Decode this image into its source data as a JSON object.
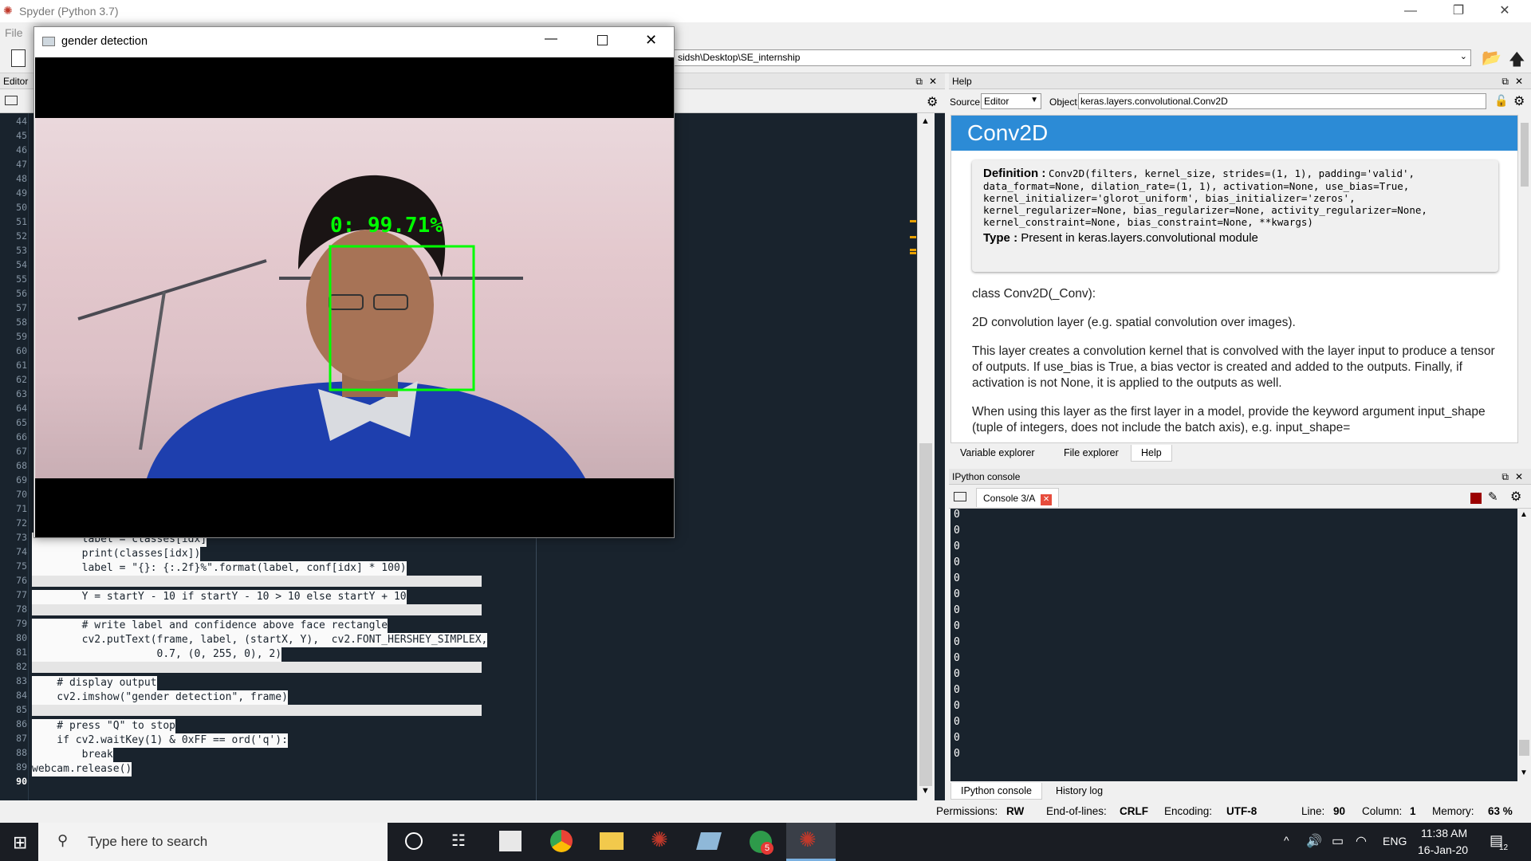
{
  "app": {
    "title": "Spyder (Python 3.7)",
    "menu_file": "File"
  },
  "toolbar": {
    "path": "sidsh\\Desktop\\SE_internship"
  },
  "editor": {
    "pane_title": "Editor",
    "line_numbers": [
      "44",
      "45",
      "46",
      "47",
      "48",
      "49",
      "50",
      "51",
      "52",
      "53",
      "54",
      "55",
      "56",
      "57",
      "58",
      "59",
      "60",
      "61",
      "62",
      "63",
      "64",
      "65",
      "66",
      "67",
      "68",
      "69",
      "70",
      "71",
      "72",
      "73",
      "74",
      "75",
      "76",
      "77",
      "78",
      "79",
      "80",
      "81",
      "82",
      "83",
      "84",
      "85",
      "86",
      "87",
      "88",
      "89",
      "90"
    ],
    "code": {
      "l73": "        label = classes[idx]",
      "l74": "        print(classes[idx])",
      "l75": "        label = \"{}: {:.2f}%\".format(label, conf[idx] * 100)",
      "l77": "        Y = startY - 10 if startY - 10 > 10 else startY + 10",
      "l79": "        # write label and confidence above face rectangle",
      "l80": "        cv2.putText(frame, label, (startX, Y),  cv2.FONT_HERSHEY_SIMPLEX,",
      "l81": "                    0.7, (0, 255, 0), 2)",
      "l83": "    # display output",
      "l84": "    cv2.imshow(\"gender detection\", frame)",
      "l86": "    # press \"Q\" to stop",
      "l87": "    if cv2.waitKey(1) & 0xFF == ord('q'):",
      "l88": "        break",
      "l89": "webcam.release()"
    }
  },
  "help": {
    "pane_title": "Help",
    "source_label": "Source",
    "source_value": "Editor",
    "object_label": "Object",
    "object_value": "keras.layers.convolutional.Conv2D",
    "heading": "Conv2D",
    "definition_label": "Definition :",
    "definition_text": "Conv2D(filters, kernel_size, strides=(1, 1), padding='valid', data_format=None, dilation_rate=(1, 1), activation=None, use_bias=True, kernel_initializer='glorot_uniform', bias_initializer='zeros', kernel_regularizer=None, bias_regularizer=None, activity_regularizer=None, kernel_constraint=None, bias_constraint=None, **kwargs)",
    "type_label": "Type :",
    "type_text": "Present in keras.layers.convolutional module",
    "p1": "class Conv2D(_Conv):",
    "p2": "2D convolution layer (e.g. spatial convolution over images).",
    "p3": "This layer creates a convolution kernel that is convolved with the layer input to produce a tensor of outputs. If use_bias is True, a bias vector is created and added to the outputs. Finally, if activation is not None, it is applied to the outputs as well.",
    "p4": "When using this layer as the first layer in a model, provide the keyword argument input_shape (tuple of integers, does not include the batch axis), e.g. input_shape=",
    "tabs": [
      "Variable explorer",
      "File explorer",
      "Help"
    ]
  },
  "console": {
    "pane_title": "IPython console",
    "tab_label": "Console 3/A",
    "outputs": [
      "0",
      "0",
      "0",
      "0",
      "0",
      "0",
      "0",
      "0",
      "0",
      "0",
      "0",
      "0",
      "0",
      "0",
      "0",
      "0"
    ],
    "tabs": [
      "IPython console",
      "History log"
    ]
  },
  "status": {
    "permissions_label": "Permissions:",
    "permissions_value": "RW",
    "eol_label": "End-of-lines:",
    "eol_value": "CRLF",
    "encoding_label": "Encoding:",
    "encoding_value": "UTF-8",
    "line_label": "Line:",
    "line_value": "90",
    "column_label": "Column:",
    "column_value": "1",
    "memory_label": "Memory:",
    "memory_value": "63 %"
  },
  "cv_window": {
    "title": "gender detection",
    "detection_label": "0: 99.71%",
    "accent": "#00ff00"
  },
  "taskbar": {
    "search_placeholder": "Type here to search",
    "time": "11:38 AM",
    "date": "16-Jan-20",
    "lang": "ENG",
    "notification_count": "12",
    "badge_count": "5"
  }
}
